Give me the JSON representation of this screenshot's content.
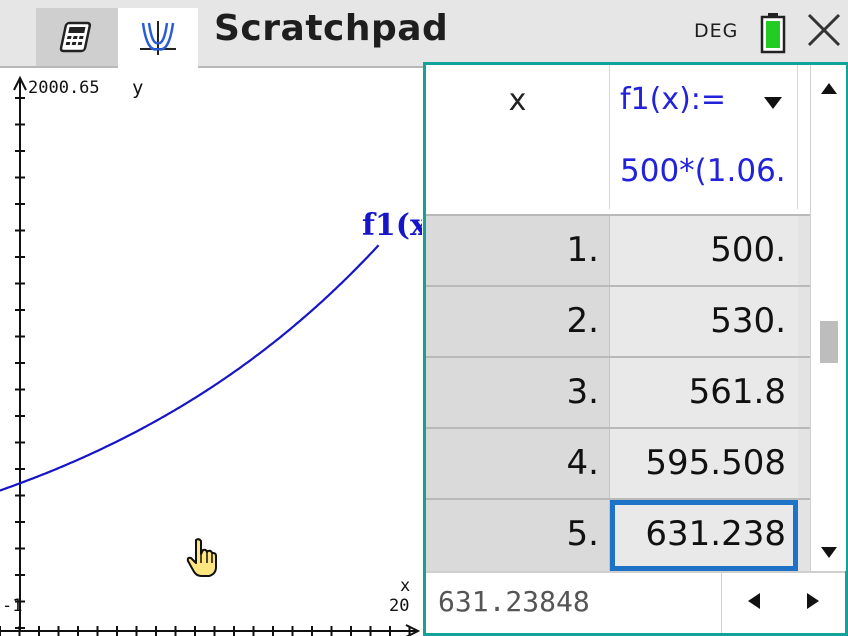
{
  "titlebar": {
    "title": "Scratchpad",
    "angle_mode": "DEG",
    "tabs": [
      {
        "name": "calculator-tab",
        "icon": "calculator-icon"
      },
      {
        "name": "graph-tab",
        "icon": "graph-icon",
        "active": true
      }
    ],
    "battery_color": "#22cc22"
  },
  "graph": {
    "ymax_label": "2000.65",
    "y_axis_name": "y",
    "x_axis_name": "x",
    "xmin_label": "-1",
    "xmax_label": "20",
    "function_label": "f1(x",
    "function_color": "#1616c8",
    "window": {
      "xmin": -1,
      "xmax": 20,
      "ymax": 2000.65
    }
  },
  "sheet": {
    "col_x_header": "x",
    "col_f_header": "f1(x):=",
    "col_f_formula": "500*(1.06.",
    "rows": [
      {
        "x": "1.",
        "f": "500."
      },
      {
        "x": "2.",
        "f": "530."
      },
      {
        "x": "3.",
        "f": "561.8"
      },
      {
        "x": "4.",
        "f": "595.508"
      },
      {
        "x": "5.",
        "f": "631.238",
        "selected": true
      }
    ],
    "entry_line_value": "631.23848",
    "accent_color": "#11a39a",
    "selection_color": "#1f73c6"
  }
}
